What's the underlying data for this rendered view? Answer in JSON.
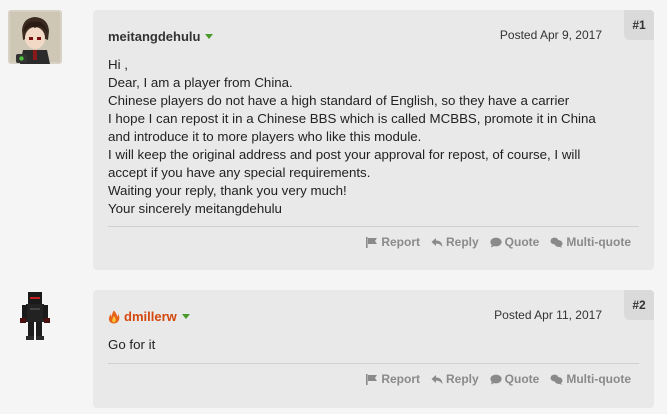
{
  "posts": [
    {
      "author": "meitangdehulu",
      "date": "Posted Apr 9, 2017",
      "number": "#1",
      "lines": [
        "Hi ,",
        "Dear, I am a player from China.",
        "Chinese players do not have a high standard of English, so they have a carrier",
        "I hope I can repost it in a Chinese BBS which is called MCBBS, promote it in China",
        "and introduce it to more players who like this module.",
        "I will keep the original address and post your approval for repost, of course, I will",
        "accept if you have any special requirements.",
        "Waiting your reply, thank you very much!",
        "Your sincerely meitangdehulu"
      ]
    },
    {
      "author": "dmillerw",
      "date": "Posted Apr 11, 2017",
      "number": "#2",
      "lines": [
        "Go for it"
      ]
    }
  ],
  "actions": {
    "report": "Report",
    "reply": "Reply",
    "quote": "Quote",
    "multiquote": "Multi-quote"
  },
  "colors": {
    "card_bg": "#e9e9e9",
    "author_staff": "#d4480f",
    "online_indicator": "#4a9a2a"
  },
  "icons": [
    "flag-icon",
    "reply-arrow-icon",
    "speech-bubble-icon",
    "multi-quote-icon",
    "flame-icon",
    "online-caret-icon"
  ]
}
